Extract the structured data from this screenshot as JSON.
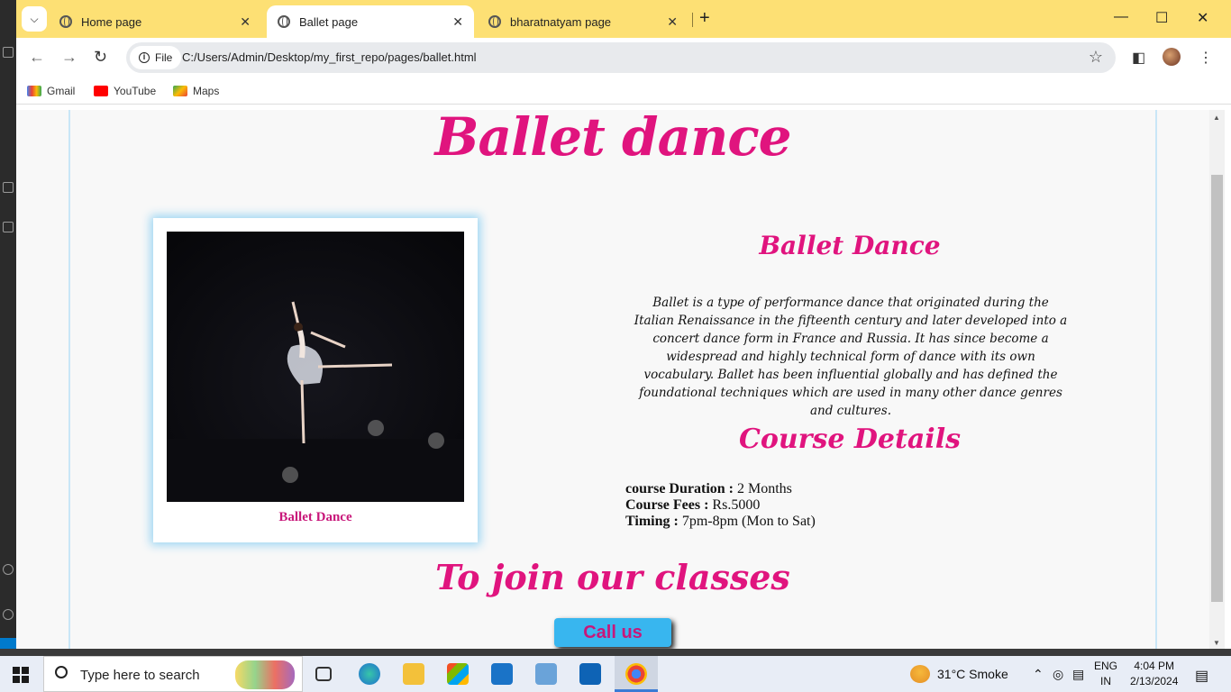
{
  "browser": {
    "tabs": [
      {
        "label": "Home page"
      },
      {
        "label": "Ballet page"
      },
      {
        "label": "bharatnatyam page"
      }
    ],
    "address": {
      "chip_label": "File",
      "url": "C:/Users/Admin/Desktop/my_first_repo/pages/ballet.html"
    },
    "bookmarks": [
      {
        "label": "Gmail"
      },
      {
        "label": "YouTube"
      },
      {
        "label": "Maps"
      }
    ]
  },
  "page": {
    "title": "Ballet dance",
    "card_caption": "Ballet Dance",
    "about_heading": "Ballet Dance",
    "about_text": "Ballet is a type of performance dance that originated during the Italian Renaissance in the fifteenth century and later developed into a concert dance form in France and Russia. It has since become a widespread and highly technical form of dance with its own vocabulary. Ballet has been influential globally and has defined the foundational techniques which are used in many other dance genres and cultures.",
    "course_heading": "Course Details",
    "details": [
      {
        "label": "course Duration :",
        "value": "2 Months"
      },
      {
        "label": "Course Fees :",
        "value": "Rs.5000"
      },
      {
        "label": "Timing :",
        "value": "7pm-8pm (Mon to Sat)"
      }
    ],
    "join_heading": "To join our classes",
    "call_button": "Call us"
  },
  "taskbar": {
    "search_placeholder": "Type here to search",
    "weather": "31°C  Smoke",
    "lang_line1": "ENG",
    "lang_line2": "IN",
    "time": "4:04 PM",
    "date": "2/13/2024"
  },
  "colors": {
    "accent_pink": "#e0147e",
    "tab_bar_yellow": "#fde074",
    "button_blue": "#38b6ef"
  }
}
